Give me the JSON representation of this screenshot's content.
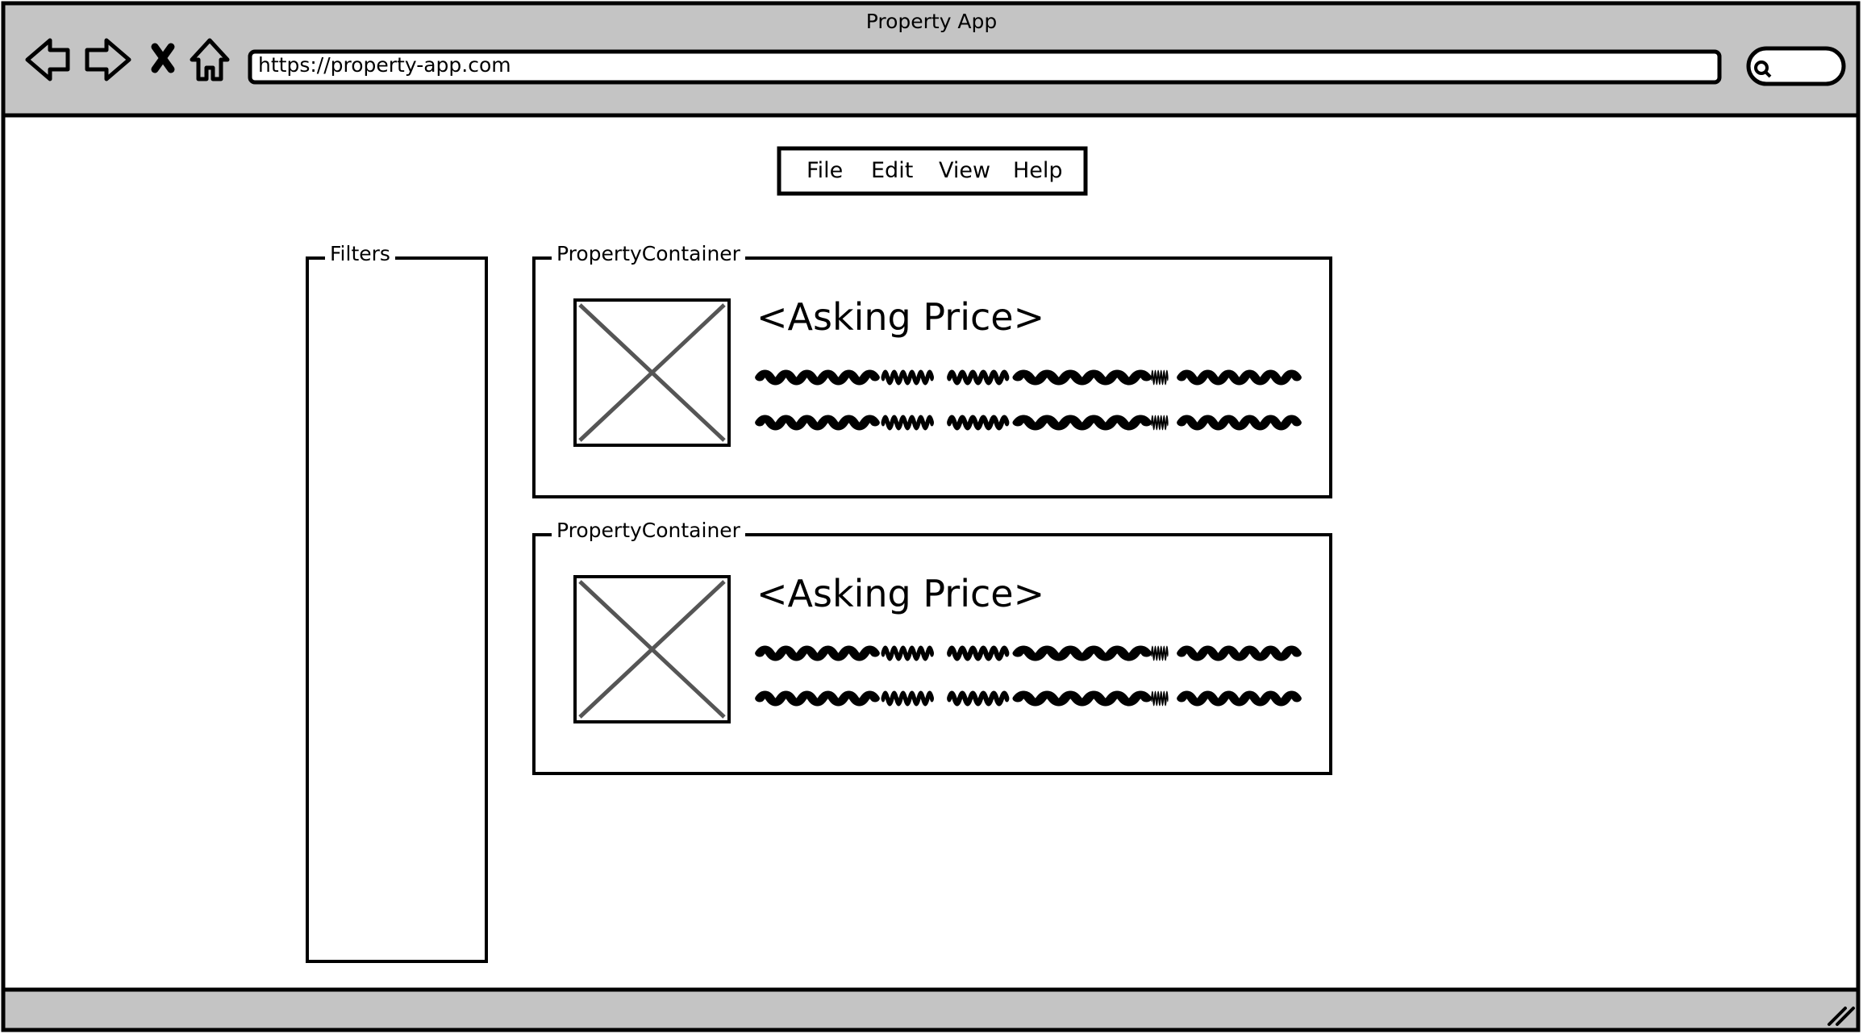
{
  "browser": {
    "title": "Property App",
    "url": "https://property-app.com",
    "nav": [
      "back-arrow-icon",
      "forward-arrow-icon",
      "stop-icon",
      "home-icon"
    ],
    "search": {
      "icon": "search-icon",
      "placeholder": ""
    }
  },
  "menu": {
    "items": [
      {
        "label": "File"
      },
      {
        "label": "Edit"
      },
      {
        "label": "View"
      },
      {
        "label": "Help"
      }
    ]
  },
  "sidebar": {
    "title": "Filters"
  },
  "properties": [
    {
      "container_label": "PropertyContainer",
      "asking_price": "<Asking Price>",
      "image": "placeholder-image-icon"
    },
    {
      "container_label": "PropertyContainer",
      "asking_price": "<Asking Price>",
      "image": "placeholder-image-icon"
    }
  ],
  "colors": {
    "chrome": "#c4c4c4",
    "stroke": "#000000",
    "placeholder_x": "#555555"
  }
}
